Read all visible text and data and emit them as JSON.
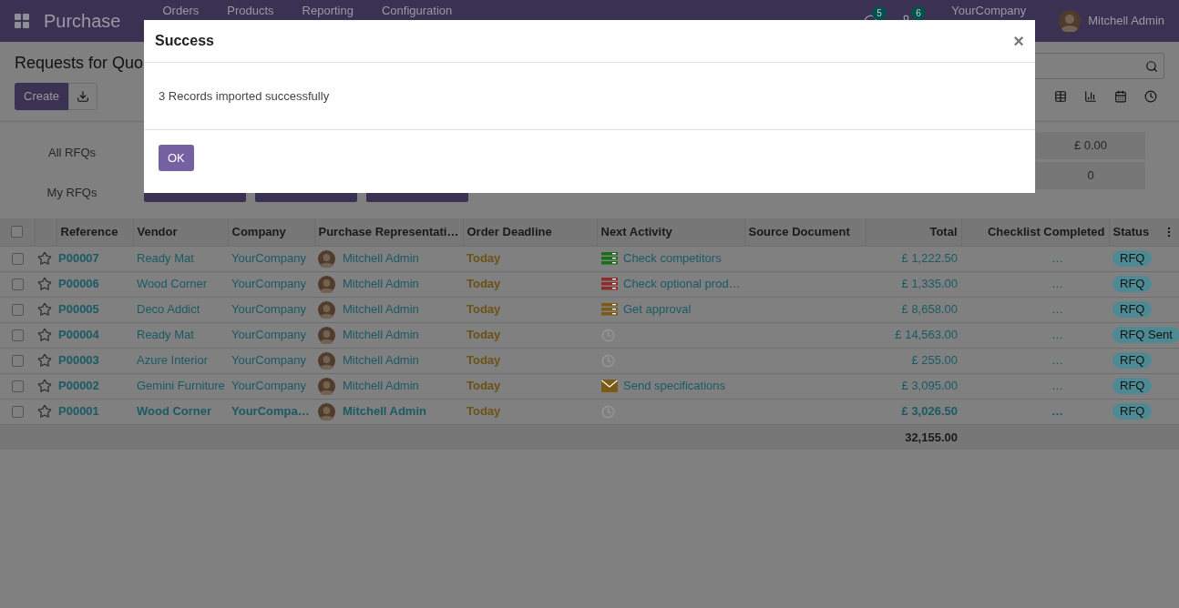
{
  "navbar": {
    "app_name": "Purchase",
    "menu": [
      "Orders",
      "Products",
      "Reporting",
      "Configuration"
    ],
    "message_count": "5",
    "activity_count": "6",
    "company": "YourCompany",
    "user": "Mitchell Admin"
  },
  "control_panel": {
    "title": "Requests for Quo",
    "create_label": "Create"
  },
  "dashboard": {
    "labels": [
      "All RFQs",
      "My RFQs"
    ],
    "right_values": [
      "£ 0.00",
      "0"
    ]
  },
  "table": {
    "select_all_checked": false,
    "columns": [
      "Reference",
      "Vendor",
      "Company",
      "Purchase Representati…",
      "Order Deadline",
      "Next Activity",
      "Source Document",
      "Total",
      "Checklist Completed",
      "Status"
    ],
    "rows": [
      {
        "reference": "P00007",
        "vendor": "Ready Mat",
        "company": "YourCompany",
        "representative": "Mitchell Admin",
        "deadline": "Today",
        "activity": {
          "kind": "list",
          "color": "#1a6e1a",
          "label": "Check competitors"
        },
        "total": "£ 1,222.50",
        "checklist": "…",
        "status": "RFQ",
        "unread": false,
        "checked": false
      },
      {
        "reference": "P00006",
        "vendor": "Wood Corner",
        "company": "YourCompany",
        "representative": "Mitchell Admin",
        "deadline": "Today",
        "activity": {
          "kind": "list",
          "color": "#8f2b2b",
          "label": "Check optional prod…"
        },
        "total": "£ 1,335.00",
        "checklist": "…",
        "status": "RFQ",
        "unread": false,
        "checked": false
      },
      {
        "reference": "P00005",
        "vendor": "Deco Addict",
        "company": "YourCompany",
        "representative": "Mitchell Admin",
        "deadline": "Today",
        "activity": {
          "kind": "list",
          "color": "#7a5a14",
          "label": "Get approval"
        },
        "total": "£ 8,658.00",
        "checklist": "…",
        "status": "RFQ",
        "unread": false,
        "checked": false
      },
      {
        "reference": "P00004",
        "vendor": "Ready Mat",
        "company": "YourCompany",
        "representative": "Mitchell Admin",
        "deadline": "Today",
        "activity": {
          "kind": "none"
        },
        "total": "£ 14,563.00",
        "checklist": "…",
        "status": "RFQ Sent",
        "unread": false,
        "checked": false
      },
      {
        "reference": "P00003",
        "vendor": "Azure Interior",
        "company": "YourCompany",
        "representative": "Mitchell Admin",
        "deadline": "Today",
        "activity": {
          "kind": "none"
        },
        "total": "£ 255.00",
        "checklist": "…",
        "status": "RFQ",
        "unread": false,
        "checked": false
      },
      {
        "reference": "P00002",
        "vendor": "Gemini Furniture",
        "company": "YourCompany",
        "representative": "Mitchell Admin",
        "deadline": "Today",
        "activity": {
          "kind": "email",
          "color": "#7a5a14",
          "label": "Send specifications"
        },
        "total": "£ 3,095.00",
        "checklist": "…",
        "status": "RFQ",
        "unread": false,
        "checked": false
      },
      {
        "reference": "P00001",
        "vendor": "Wood Corner",
        "company": "YourCompa…",
        "representative": "Mitchell Admin",
        "deadline": "Today",
        "activity": {
          "kind": "none"
        },
        "total": "£ 3,026.50",
        "checklist": "…",
        "status": "RFQ",
        "unread": true,
        "checked": false
      }
    ],
    "footer_total": "32,155.00"
  },
  "dialog": {
    "title": "Success",
    "close": "×",
    "message": "3 Records imported successfully",
    "button": "OK"
  }
}
